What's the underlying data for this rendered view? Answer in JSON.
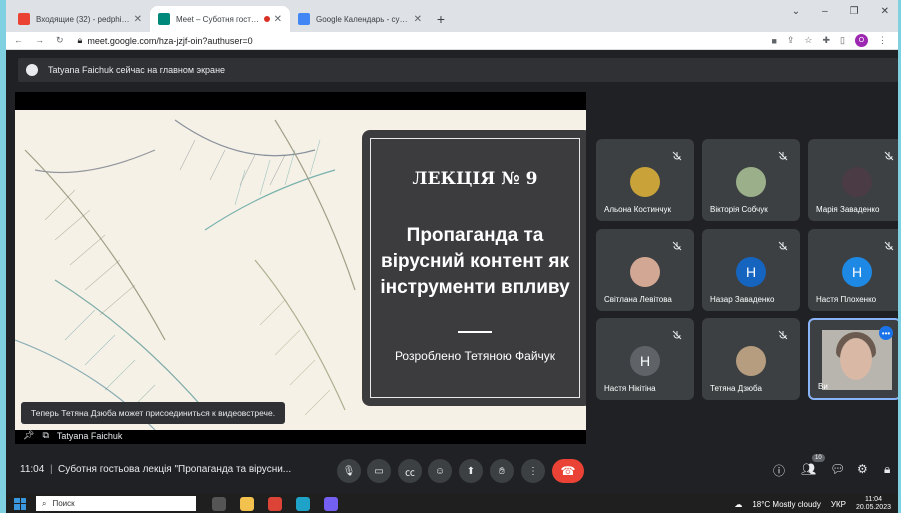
{
  "tabs": [
    {
      "title": "Входящие (32) - pedphilol@gm",
      "favicon_color": "#ea4335",
      "active": false
    },
    {
      "title": "Meet – Суботня гостьова л",
      "favicon_color": "#00897b",
      "active": true
    },
    {
      "title": "Google Календарь - суббота, 20",
      "favicon_color": "#4285f4",
      "active": false
    }
  ],
  "address": {
    "url": "meet.google.com/hza-jzjf-oin?authuser=0",
    "profile_initial": "O"
  },
  "presenter_notice": "Tatyana Faichuk сейчас на главном экране",
  "slide": {
    "lecture": "ЛЕКЦІЯ № 9",
    "topic_lines": [
      "Пропаганда та",
      "вірусний контент як",
      "інструменти впливу"
    ],
    "author": "Розроблено Тетяною Файчук"
  },
  "toast": "Теперь Тетяна Дзюба может присоединиться к видеовстрече.",
  "presenter_name": "Tatyana Faichuk",
  "participants": [
    {
      "name": "Альона Костинчук",
      "initial": "",
      "color": "#c9a23a"
    },
    {
      "name": "Вікторія Собчук",
      "initial": "",
      "color": "#9bb08a"
    },
    {
      "name": "Марія Заваденко",
      "initial": "",
      "color": "#4a3b45"
    },
    {
      "name": "Світлана Левітова",
      "initial": "",
      "color": "#d2a894"
    },
    {
      "name": "Назар Заваденко",
      "initial": "Н",
      "color": "#1565c0"
    },
    {
      "name": "Настя Плохенко",
      "initial": "Н",
      "color": "#1e88e5"
    },
    {
      "name": "Настя Нікітіна",
      "initial": "Н",
      "color": "#5f6368"
    },
    {
      "name": "Тетяна Дзюба",
      "initial": "",
      "color": "#b79d7f"
    },
    {
      "name": "Ви",
      "initial": "",
      "color": "#b8b4ae"
    }
  ],
  "bottom": {
    "time": "11:04",
    "separator": "|",
    "meeting_title": "Суботня гостьова лекція \"Пропаганда та вірусни...",
    "participant_count": "10"
  },
  "taskbar": {
    "search_placeholder": "Поиск",
    "weather": "18°C  Mostly cloudy",
    "language": "УКР",
    "clock_time": "11:04",
    "clock_date": "20.05.2023"
  },
  "colors": {
    "accent": "#8ab4f8",
    "end_call": "#ea4335",
    "frame": "#7fd0e0"
  }
}
